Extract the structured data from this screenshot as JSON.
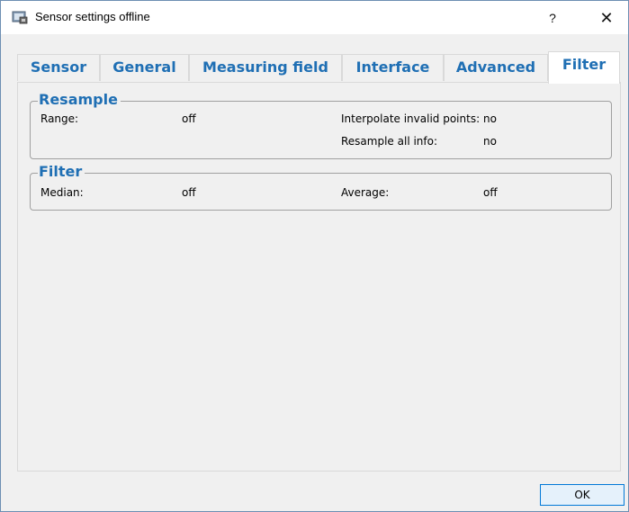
{
  "window": {
    "title": "Sensor settings offline",
    "help_label": "?",
    "close_label": "✕"
  },
  "tabs": [
    {
      "label": "Sensor"
    },
    {
      "label": "General"
    },
    {
      "label": "Measuring field"
    },
    {
      "label": "Interface"
    },
    {
      "label": "Advanced"
    },
    {
      "label": "Filter",
      "active": true
    }
  ],
  "resample": {
    "title": "Resample",
    "range_label": "Range:",
    "range_value": "off",
    "interpolate_label": "Interpolate invalid points:",
    "interpolate_value": "no",
    "resample_all_label": "Resample all info:",
    "resample_all_value": "no"
  },
  "filter": {
    "title": "Filter",
    "median_label": "Median:",
    "median_value": "off",
    "average_label": "Average:",
    "average_value": "off"
  },
  "buttons": {
    "ok_label": "OK"
  },
  "colors": {
    "accent": "#1f6fb4",
    "window_border": "#6d8fb3",
    "panel_bg": "#f0f0f0"
  }
}
